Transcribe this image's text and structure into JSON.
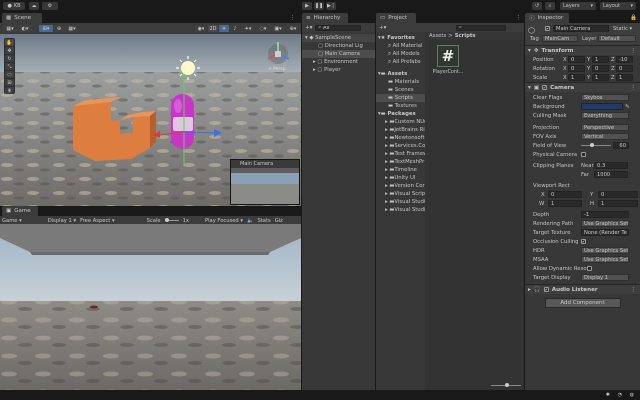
{
  "topbar": {
    "account": "KB",
    "layers": "Layers",
    "layout": "Layout"
  },
  "scene": {
    "tab": "Scene",
    "toggle_2d": "2D",
    "persp_label": "< Persp",
    "preview_title": "Main Camera"
  },
  "game": {
    "tab": "Game",
    "mode": "Game",
    "display": "Display 1",
    "aspect": "Free Aspect",
    "scale_label": "Scale",
    "scale_value": "1x",
    "play_focus": "Play Focused",
    "stats": "Stats",
    "gizmos": "Giz"
  },
  "hierarchy": {
    "tab": "Hierarchy",
    "search_placeholder": "All",
    "items": [
      "SampleScene",
      "Directional Lig",
      "Main Camera",
      "Environment",
      "Player"
    ]
  },
  "project": {
    "tab": "Project",
    "breadcrumb_root": "Assets",
    "breadcrumb_sep": ">",
    "breadcrumb_leaf": "Scripts",
    "favorites": {
      "label": "Favorites",
      "items": [
        "All Material",
        "All Models",
        "All Prefabs"
      ]
    },
    "assets": {
      "label": "Assets",
      "items": [
        "Materials",
        "Scenes",
        "Scripts",
        "Textures"
      ]
    },
    "packages": {
      "label": "Packages",
      "items": [
        "Custom NUn",
        "JetBrains Ri",
        "Newtonsoft",
        "Services.Co",
        "Test Framew",
        "TextMeshPr",
        "Timeline",
        "Unity UI",
        "Version Cor",
        "Visual Scrip",
        "Visual Studi",
        "Visual Studi"
      ]
    },
    "file": {
      "name": "PlayerCont...",
      "icon_glyph": "#"
    }
  },
  "inspector": {
    "tab": "Inspector",
    "object_name": "Main Camera",
    "static_label": "Static",
    "tag_label": "Tag",
    "tag_value": "MainCam",
    "layer_label": "Layer",
    "layer_value": "Default",
    "transform": {
      "title": "Transform",
      "rows": [
        {
          "label": "Position",
          "x": "0",
          "y": "1",
          "z": "-10"
        },
        {
          "label": "Rotation",
          "x": "0",
          "y": "0",
          "z": "0"
        },
        {
          "label": "Scale",
          "x": "1",
          "y": "1",
          "z": "1"
        }
      ]
    },
    "camera": {
      "title": "Camera",
      "clear_flags": {
        "label": "Clear Flags",
        "value": "Skybox"
      },
      "background": {
        "label": "Background"
      },
      "culling": {
        "label": "Culling Mask",
        "value": "Everything"
      },
      "projection": {
        "label": "Projection",
        "value": "Perspective"
      },
      "fov_axis": {
        "label": "FOV Axis",
        "value": "Vertical"
      },
      "fov": {
        "label": "Field of View",
        "value": "60",
        "fraction": 0.33
      },
      "physical": {
        "label": "Physical Camera"
      },
      "clipping": {
        "label": "Clipping Planes",
        "near_label": "Near",
        "near": "0.3",
        "far_label": "Far",
        "far": "1000"
      },
      "viewport": {
        "label": "Viewport Rect",
        "x": "0",
        "y": "0",
        "w": "1",
        "h": "1"
      },
      "depth": {
        "label": "Depth",
        "value": "-1"
      },
      "rendering_path": {
        "label": "Rendering Path",
        "value": "Use Graphics Set"
      },
      "target_texture": {
        "label": "Target Texture",
        "value": "None (Render Te"
      },
      "occlusion": {
        "label": "Occlusion Culling"
      },
      "hdr": {
        "label": "HDR",
        "value": "Use Graphics Set"
      },
      "msaa": {
        "label": "MSAA",
        "value": "Use Graphics Set"
      },
      "dynamic_res": {
        "label": "Allow Dynamic Resol"
      },
      "target_display": {
        "label": "Target Display",
        "value": "Display 1"
      }
    },
    "audio_listener": {
      "title": "Audio Listener"
    },
    "add_component": "Add Component"
  },
  "colors": {
    "accent": "#3a79bb",
    "panel": "#383838",
    "capsule": "#c835c8",
    "box": "#de7d40"
  }
}
